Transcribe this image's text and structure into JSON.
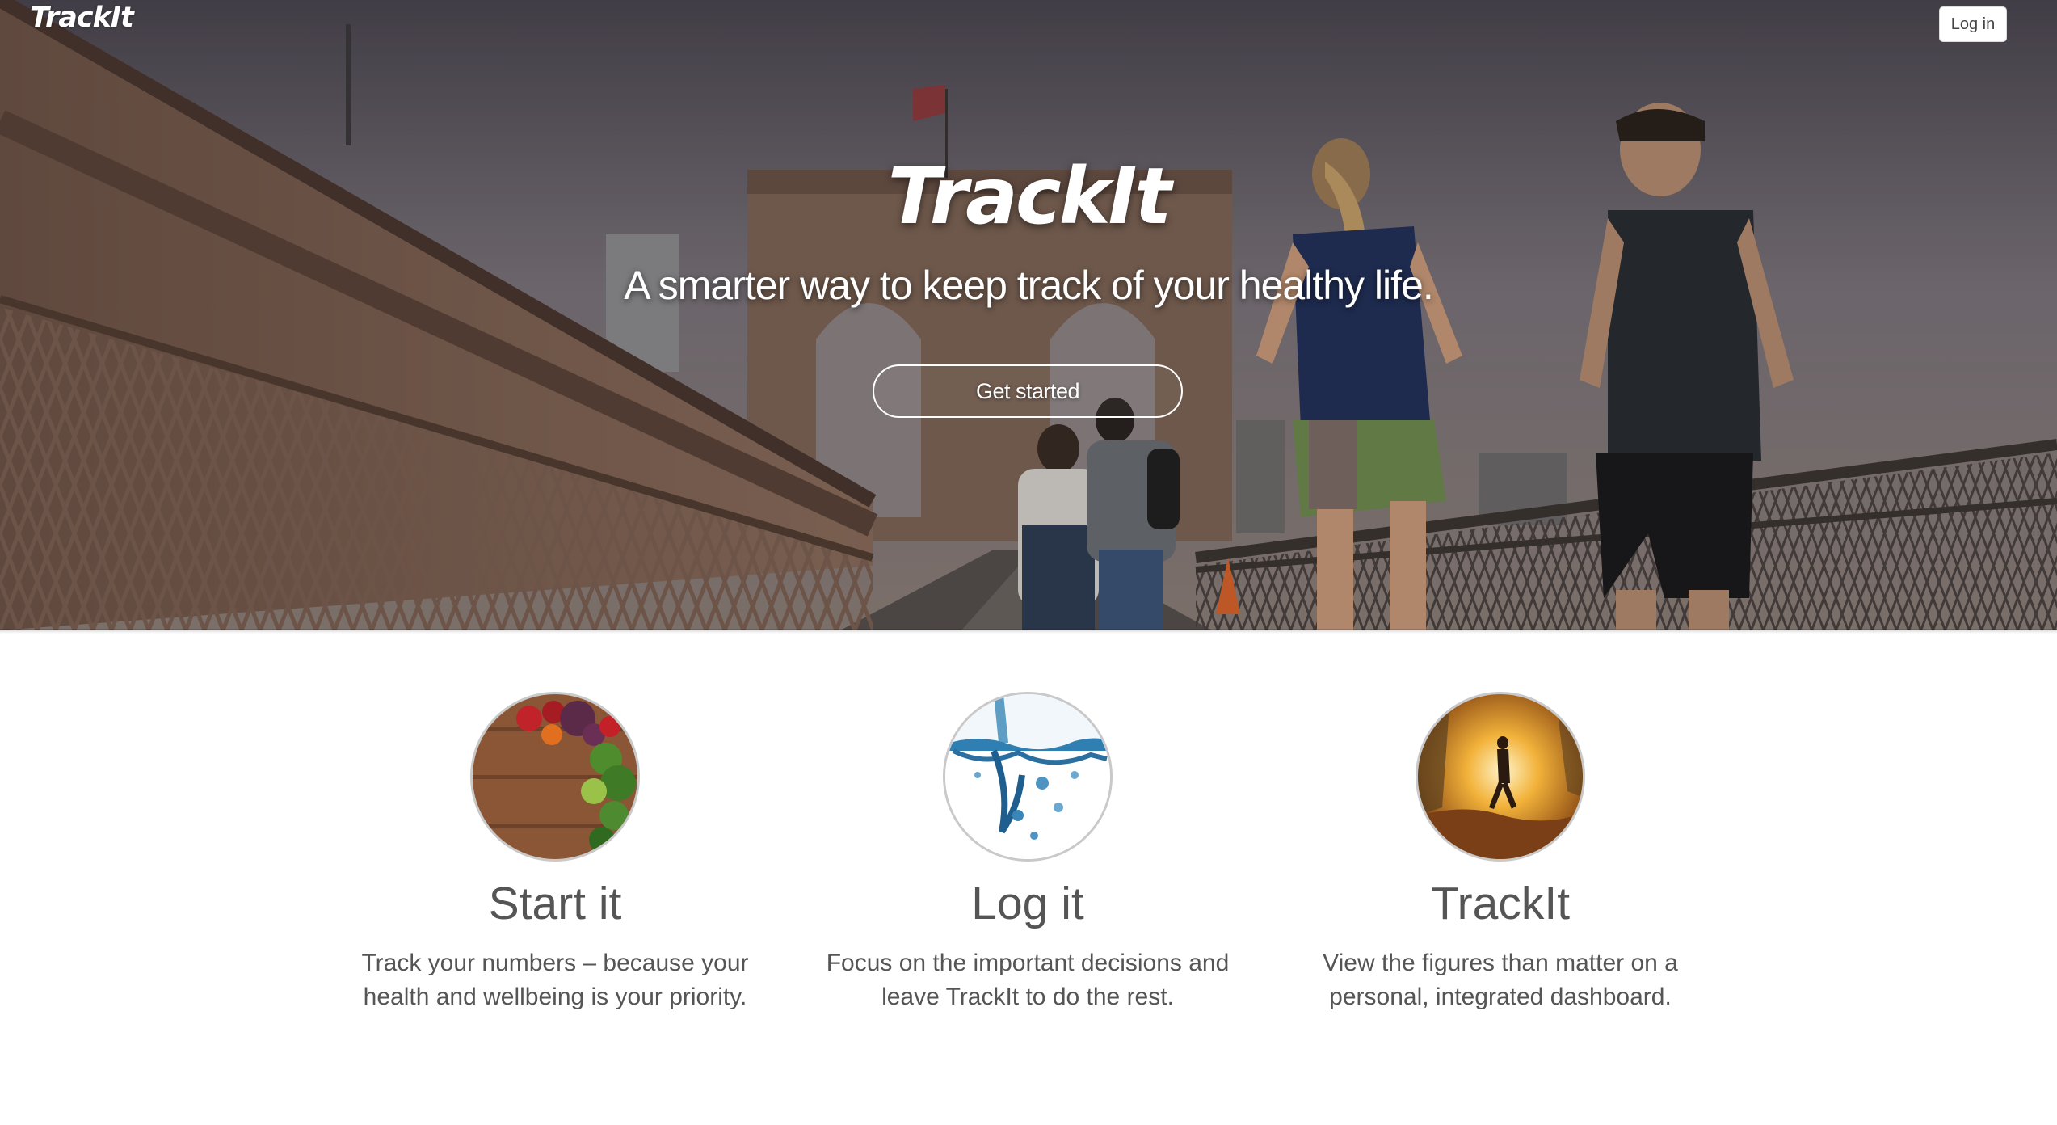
{
  "header": {
    "brand": "TrackIt",
    "login_label": "Log in"
  },
  "hero": {
    "title": "TrackIt",
    "subtitle": "A smarter way to keep track of your healthy life.",
    "cta_label": "Get started",
    "background_description_icon": "bridge-runners-photo"
  },
  "features": [
    {
      "image_icon": "fruit-vegetables-photo",
      "title": "Start it",
      "text": "Track your numbers – because your health and wellbeing is your priority."
    },
    {
      "image_icon": "water-splash-photo",
      "title": "Log it",
      "text": "Focus on the important decisions and leave TrackIt to do the rest."
    },
    {
      "image_icon": "sunset-runner-photo",
      "title": "TrackIt",
      "text": "View the figures than matter on a personal, integrated dashboard."
    }
  ],
  "colors": {
    "text_gray": "#555555",
    "hero_text": "#ffffff",
    "circle_border": "#c9c9c9"
  }
}
